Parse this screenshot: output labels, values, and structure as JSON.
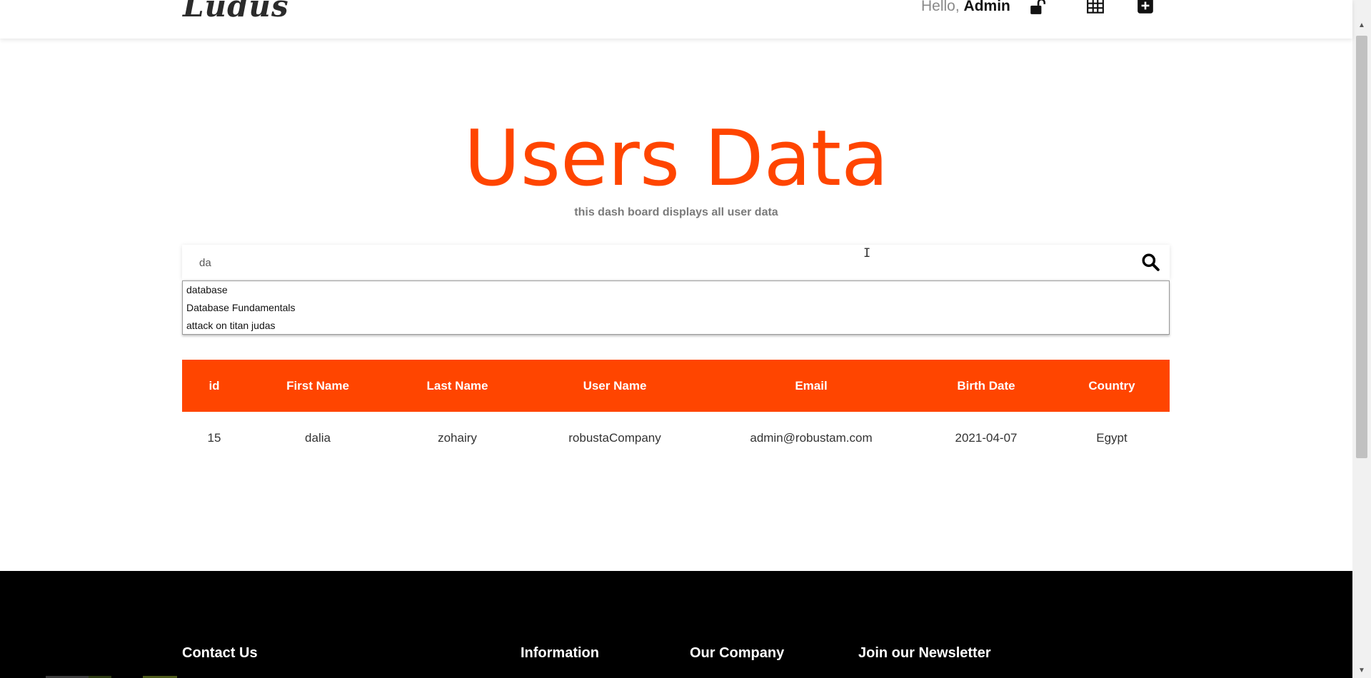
{
  "header": {
    "logo": "Ludus",
    "greeting": "Hello,",
    "user": "Admin",
    "icons": [
      "lock-open-icon",
      "table-icon",
      "plus-square-icon"
    ]
  },
  "hero": {
    "title": "Users Data",
    "subtitle": "this dash board displays all user data"
  },
  "search": {
    "value": "da",
    "suggestions": [
      "database",
      "Database Fundamentals",
      "attack on titan judas"
    ]
  },
  "table": {
    "headers": [
      "id",
      "First Name",
      "Last Name",
      "User Name",
      "Email",
      "Birth Date",
      "Country"
    ],
    "rows": [
      [
        "15",
        "dalia",
        "zohairy",
        "robustaCompany",
        "admin@robustam.com",
        "2021-04-07",
        "Egypt"
      ]
    ]
  },
  "footer": {
    "columns": [
      "Contact Us",
      "Information",
      "Our Company",
      "Join our Newsletter"
    ]
  },
  "colors": {
    "accent": "#ff4500",
    "footer_bg": "#000000"
  }
}
